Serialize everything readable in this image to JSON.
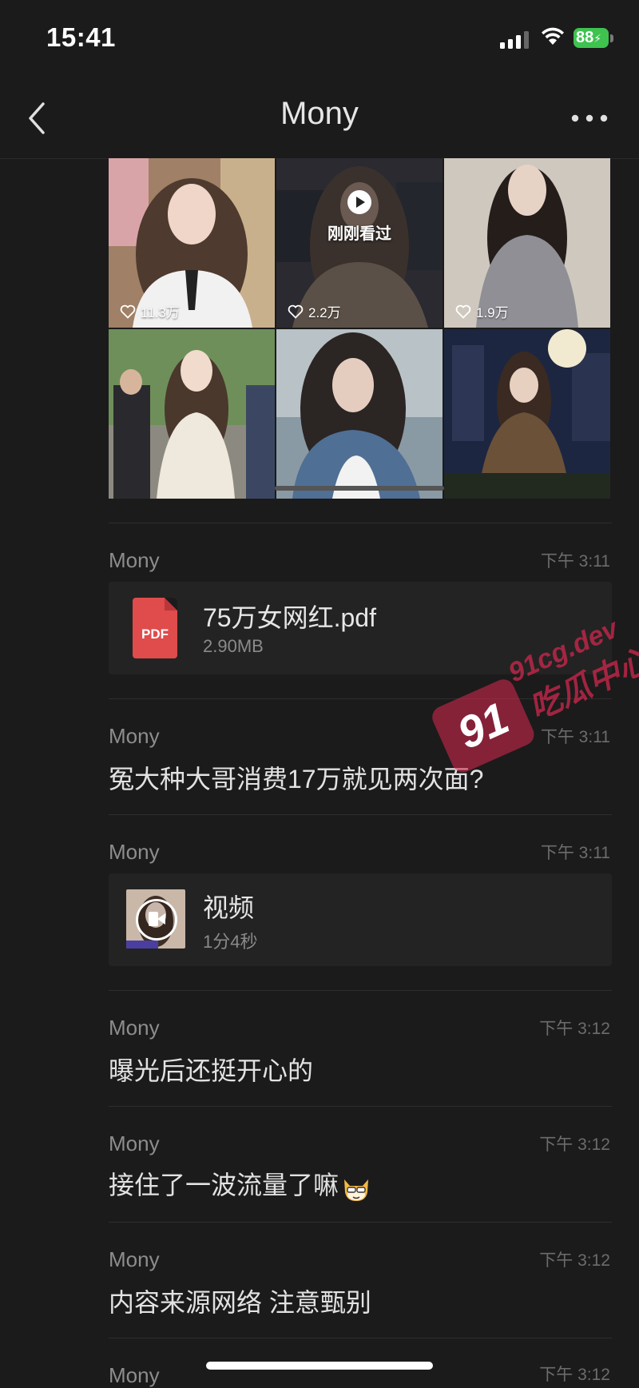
{
  "status_bar": {
    "time": "15:41",
    "battery": "88"
  },
  "nav": {
    "title": "Mony"
  },
  "grid": {
    "tiles": [
      {
        "likes": "11.3万"
      },
      {
        "likes": "2.2万",
        "overlay": "刚刚看过"
      },
      {
        "likes": "1.9万"
      },
      {},
      {},
      {}
    ]
  },
  "messages": [
    {
      "type": "file",
      "sender": "Mony",
      "time": "下午 3:11",
      "file_name": "75万女网红.pdf",
      "file_size": "2.90MB",
      "icon_label": "PDF"
    },
    {
      "type": "text",
      "sender": "Mony",
      "time": "下午 3:11",
      "text": "冤大种大哥消费17万就见两次面?"
    },
    {
      "type": "video",
      "sender": "Mony",
      "time": "下午 3:11",
      "title": "视频",
      "duration": "1分4秒"
    },
    {
      "type": "text",
      "sender": "Mony",
      "time": "下午 3:12",
      "text": "曝光后还挺开心的"
    },
    {
      "type": "text",
      "sender": "Mony",
      "time": "下午 3:12",
      "text": "接住了一波流量了嘛"
    },
    {
      "type": "text",
      "sender": "Mony",
      "time": "下午 3:12",
      "text": "内容来源网络 注意甄别"
    },
    {
      "type": "partial",
      "sender": "Mony",
      "time": "下午 3:12"
    }
  ],
  "watermark": {
    "badge": "91",
    "domain": "91cg.dev",
    "name": "吃瓜中心"
  },
  "colors": {
    "background": "#1b1b1b",
    "card": "#232323",
    "pdf_red": "#e04b4c",
    "battery_green": "#3ec34f"
  }
}
